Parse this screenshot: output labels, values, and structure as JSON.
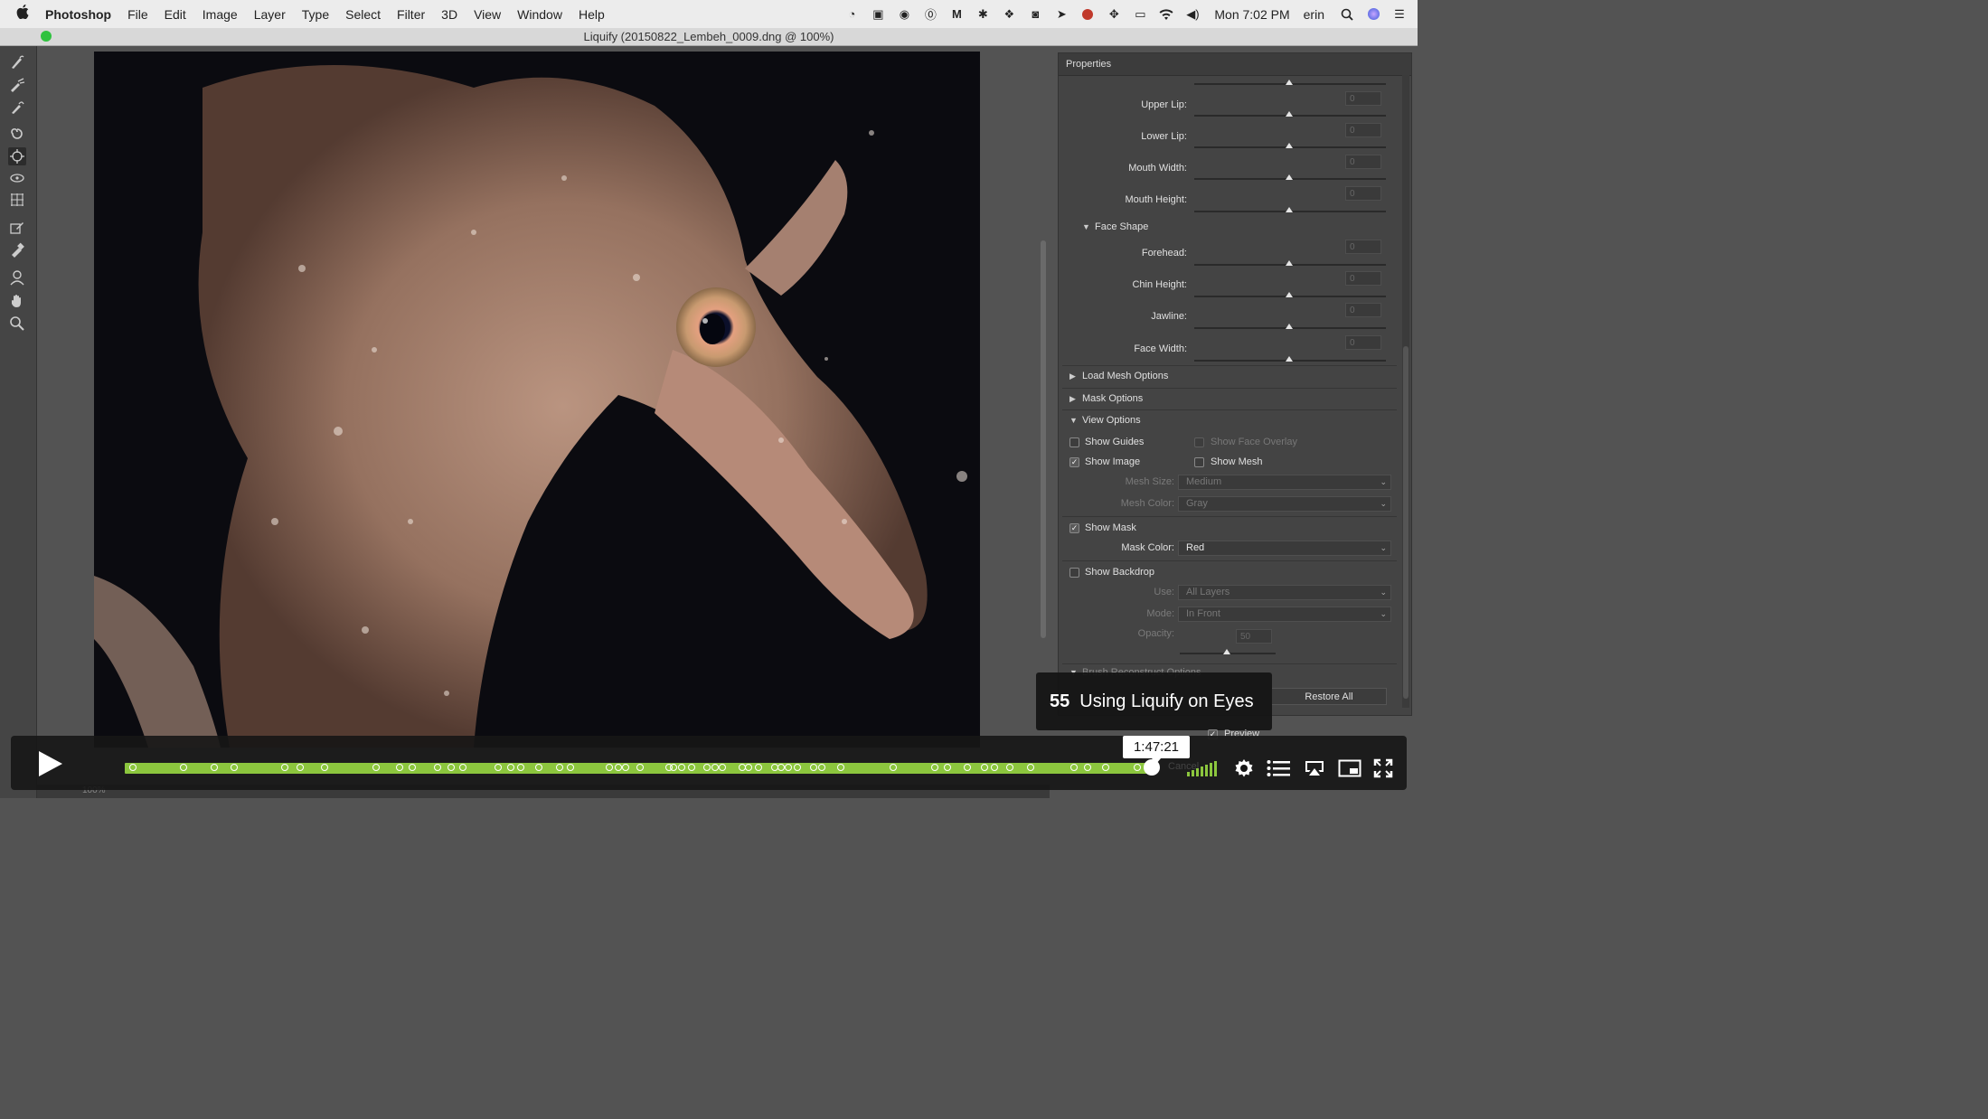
{
  "menubar": {
    "app": "Photoshop",
    "items": [
      "File",
      "Edit",
      "Image",
      "Layer",
      "Type",
      "Select",
      "Filter",
      "3D",
      "View",
      "Window",
      "Help"
    ],
    "clock": "Mon 7:02 PM",
    "user": "erin"
  },
  "window": {
    "title": "Liquify (20150822_Lembeh_0009.dng @ 100%)"
  },
  "properties": {
    "header": "Properties",
    "sliders": [
      {
        "label": "Upper Lip:",
        "value": "0"
      },
      {
        "label": "Lower Lip:",
        "value": "0"
      },
      {
        "label": "Mouth Width:",
        "value": "0"
      },
      {
        "label": "Mouth Height:",
        "value": "0"
      }
    ],
    "face_shape_title": "Face Shape",
    "face_sliders": [
      {
        "label": "Forehead:",
        "value": "0"
      },
      {
        "label": "Chin Height:",
        "value": "0"
      },
      {
        "label": "Jawline:",
        "value": "0"
      },
      {
        "label": "Face Width:",
        "value": "0"
      }
    ],
    "load_mesh": "Load Mesh Options",
    "mask_options": "Mask Options",
    "view_options": "View Options",
    "show_guides": "Show Guides",
    "show_face_overlay": "Show Face Overlay",
    "show_image": "Show Image",
    "show_mesh": "Show Mesh",
    "mesh_size_label": "Mesh Size:",
    "mesh_size_value": "Medium",
    "mesh_color_label": "Mesh Color:",
    "mesh_color_value": "Gray",
    "show_mask": "Show Mask",
    "mask_color_label": "Mask Color:",
    "mask_color_value": "Red",
    "show_backdrop": "Show Backdrop",
    "use_label": "Use:",
    "use_value": "All Layers",
    "mode_label": "Mode:",
    "mode_value": "In Front",
    "opacity_label": "Opacity:",
    "opacity_value": "50",
    "brush_reconstruct": "Brush Reconstruct Options",
    "restore_all": "Restore All",
    "preview": "Preview",
    "cancel": "Cancel"
  },
  "overlay": {
    "lesson_number": "55",
    "lesson_title": "Using Liquify on Eyes",
    "timestamp": "1:47:21"
  },
  "player": {
    "progress": 0.999,
    "chapter_positions": [
      0.004,
      0.054,
      0.084,
      0.103,
      0.153,
      0.168,
      0.192,
      0.242,
      0.265,
      0.277,
      0.302,
      0.315,
      0.327,
      0.361,
      0.374,
      0.383,
      0.401,
      0.421,
      0.432,
      0.47,
      0.479,
      0.486,
      0.5,
      0.528,
      0.533,
      0.541,
      0.55,
      0.565,
      0.573,
      0.58,
      0.6,
      0.606,
      0.616,
      0.632,
      0.638,
      0.645,
      0.654,
      0.67,
      0.678,
      0.696,
      0.747,
      0.788,
      0.8,
      0.82,
      0.837,
      0.846,
      0.861,
      0.882,
      0.924,
      0.937,
      0.955,
      0.986
    ]
  },
  "bottom": {
    "zoom": "100%"
  },
  "colors": {
    "progress": "#8cc63e",
    "panel": "#444444",
    "canvas": "#535353"
  }
}
